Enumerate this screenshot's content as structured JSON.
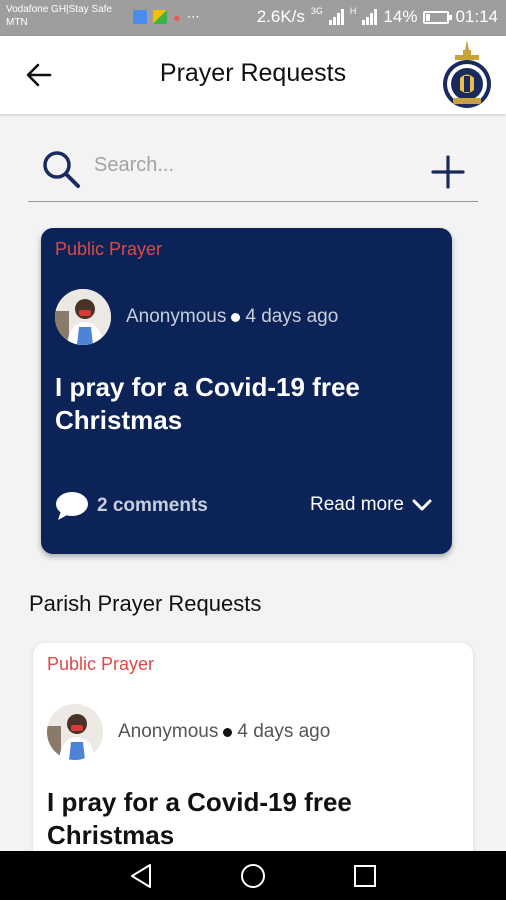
{
  "status_bar": {
    "carrier": "Vodafone GH|Stay Safe MTN",
    "speed": "2.6K/s",
    "net_3g": "3G",
    "net_h": "H",
    "battery": "14%",
    "time": "01:14"
  },
  "header": {
    "title": "Prayer Requests"
  },
  "search": {
    "placeholder": "Search..."
  },
  "featured_card": {
    "tag": "Public Prayer",
    "author": "Anonymous",
    "time": "4 days ago",
    "title": "I pray for a Covid-19 free Christmas",
    "comments": "2 comments",
    "read_more": "Read more"
  },
  "section": {
    "title": "Parish Prayer Requests"
  },
  "parish_card": {
    "tag": "Public Prayer",
    "author": "Anonymous",
    "time": "4 days ago",
    "title": "I pray for a Covid-19 free Christmas"
  },
  "colors": {
    "featured_bg": "#0b2357",
    "tag_red": "#e04848",
    "accent_navy": "#1b2a5c"
  }
}
